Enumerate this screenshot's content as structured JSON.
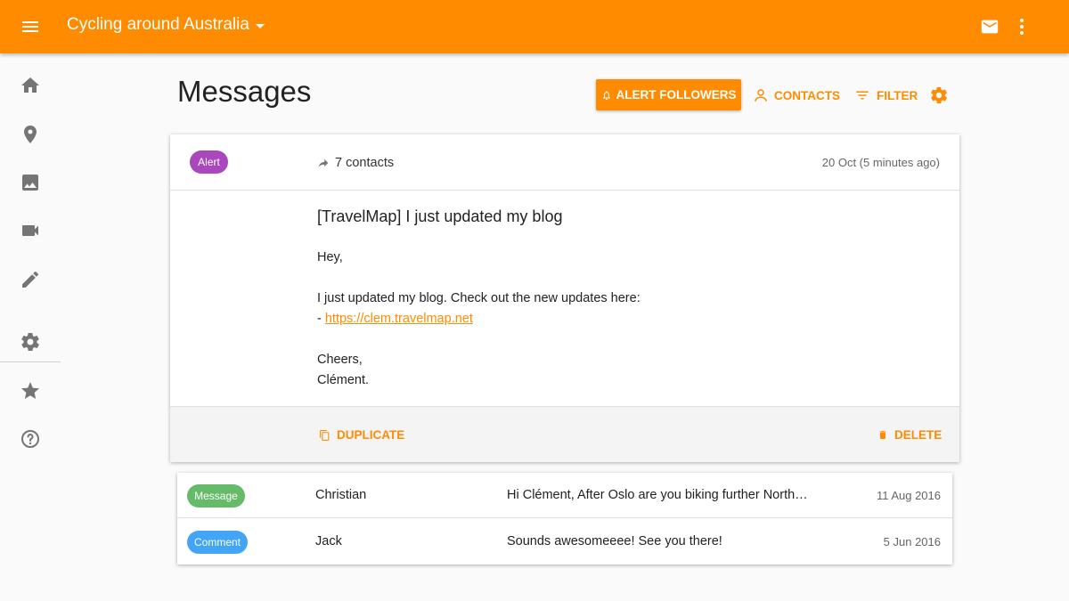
{
  "appbar": {
    "title": "Cycling around Australia",
    "color": "#ff8c00",
    "icons": [
      "menu-icon",
      "chevron-down-icon",
      "mail-icon",
      "more-vert-icon"
    ]
  },
  "sidenav": {
    "items": [
      {
        "icon": "home-icon"
      },
      {
        "icon": "map-pin-icon"
      },
      {
        "icon": "image-icon"
      },
      {
        "icon": "video-icon"
      },
      {
        "icon": "pencil-icon"
      },
      {
        "icon": "settings-icon"
      },
      {
        "icon": "star-icon"
      },
      {
        "icon": "help-icon"
      }
    ]
  },
  "header": {
    "title": "Messages",
    "alert_followers_label": "ALERT FOLLOWERS",
    "contacts_label": "CONTACTS",
    "filter_label": "FILTER"
  },
  "expanded_message": {
    "type": "Alert",
    "type_color": "#ab47bc",
    "recipients": "7 contacts",
    "date": "20 Oct (5 minutes ago)",
    "subject": "[TravelMap] I just updated my blog",
    "greeting": "Hey,",
    "line1": "I just updated my blog. Check out the new updates here:",
    "link_prefix": "- ",
    "link": "https://clem.travelmap.net",
    "signoff": "Cheers,",
    "signature": "Clément.",
    "duplicate_label": "DUPLICATE",
    "delete_label": "DELETE"
  },
  "messages": [
    {
      "type": "Message",
      "type_color": "#66bb6a",
      "sender": "Christian",
      "preview": "Hi Clément, After Oslo are you biking further North? I was wondering",
      "date": "11 Aug 2016"
    },
    {
      "type": "Comment",
      "type_color": "#42a5f5",
      "sender": "Jack",
      "preview": "Sounds awesomeeee! See you there!",
      "date": "5 Jun 2016"
    }
  ]
}
